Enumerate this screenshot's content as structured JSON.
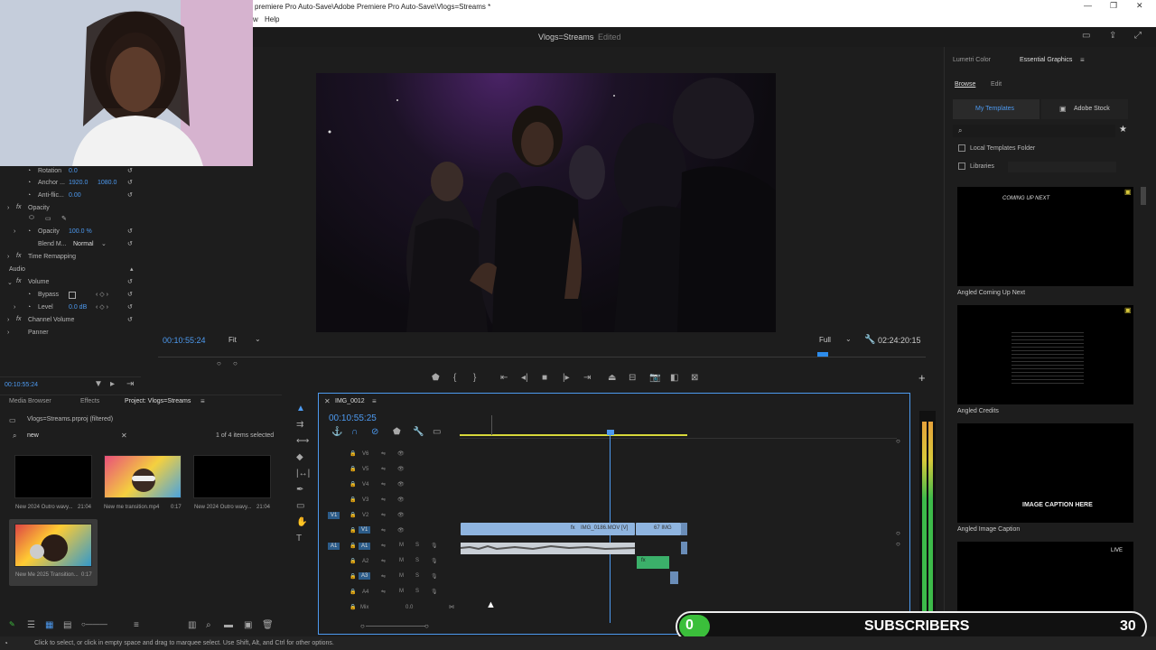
{
  "window": {
    "title": "premiere Pro Auto-Save\\Adobe Premiere Pro Auto-Save\\Vlogs=Streams *",
    "menu_items": [
      "w",
      "Help"
    ]
  },
  "header": {
    "sequence_name": "Vlogs=Streams",
    "edited": "Edited"
  },
  "effect_controls": {
    "rotation_label": "Rotation",
    "rotation_value": "0.0",
    "anchor_label": "Anchor ...",
    "anchor_x": "1920.0",
    "anchor_y": "1080.0",
    "antiflicker_label": "Anti-flic...",
    "antiflicker_value": "0.00",
    "opacity_section": "Opacity",
    "opacity_label": "Opacity",
    "opacity_value": "100.0 %",
    "blend_label": "Blend M...",
    "blend_value": "Normal",
    "time_remapping": "Time Remapping",
    "audio_section": "Audio",
    "volume_label": "Volume",
    "bypass_label": "Bypass",
    "level_label": "Level",
    "level_value": "0.0 dB",
    "channel_volume": "Channel Volume",
    "panner": "Panner",
    "timecode": "00:10:55:24"
  },
  "program": {
    "timecode": "00:10:55:24",
    "fit": "Fit",
    "quality": "Full",
    "duration": "02:24:20:15"
  },
  "project": {
    "tabs": [
      "Media Browser",
      "Effects",
      "Project: Vlogs=Streams"
    ],
    "file_name": "Vlogs=Streams.prproj (filtered)",
    "search_value": "new",
    "selection_status": "1 of 4 items selected",
    "items": [
      {
        "name": "New 2024 Outro wavy...",
        "duration": "21:04"
      },
      {
        "name": "New me transition.mp4",
        "duration": "0:17"
      },
      {
        "name": "New 2024 Outro wavy...",
        "duration": "21:04"
      },
      {
        "name": "New Me 2025 Transition...",
        "duration": "0:17"
      }
    ]
  },
  "timeline": {
    "sequence_tab": "IMG_0012",
    "timecode": "00:10:55:25",
    "video_tracks": [
      "V6",
      "V5",
      "V4",
      "V3",
      "V2",
      "V1"
    ],
    "audio_tracks": [
      "A1",
      "A2",
      "A3",
      "A4"
    ],
    "source_v": "V1",
    "source_a": "A1",
    "mix_label": "Mix",
    "mix_value": "0.0",
    "clip_v1": "IMG_0186.MOV [V]",
    "clip_v1b": "67 IMG",
    "clip_a2": "fx"
  },
  "essential_graphics": {
    "tabs": [
      "Lumetri Color",
      "Essential Graphics"
    ],
    "subtabs": [
      "Browse",
      "Edit"
    ],
    "sources": [
      "My Templates",
      "Adobe Stock"
    ],
    "local_templates": "Local Templates Folder",
    "libraries": "Libraries",
    "templates": [
      {
        "name": "Angled Coming Up Next",
        "preview": "COMING UP NEXT"
      },
      {
        "name": "Angled Credits",
        "preview": ""
      },
      {
        "name": "Angled Image Caption",
        "preview": "IMAGE CAPTION HERE"
      },
      {
        "name": "",
        "preview": "LIVE"
      }
    ]
  },
  "status_bar": {
    "text": "Click to select, or click in empty space and drag to marquee select. Use Shift, Alt, and Ctrl for other options."
  },
  "overlay": {
    "count": "0",
    "label": "SUBSCRIBERS",
    "goal": "30"
  }
}
